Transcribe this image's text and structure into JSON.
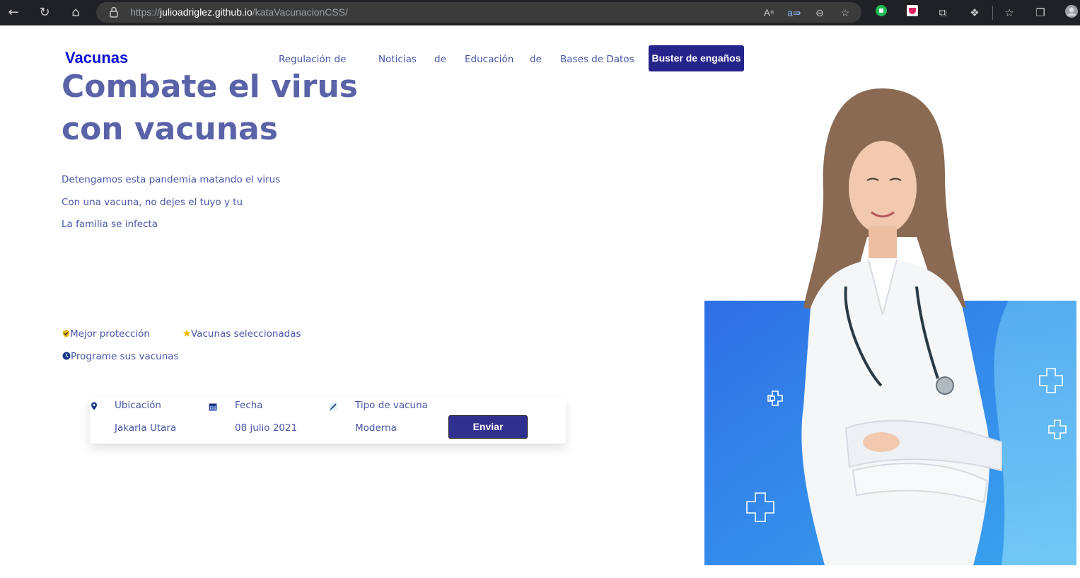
{
  "browser": {
    "url_prefix": "https://",
    "url_host": "julioadriglez.github.io",
    "url_path": "/kataVacunacionCSS/",
    "reader_icon_label": "Aᵀ"
  },
  "header": {
    "logo": "Vacunas",
    "nav": [
      {
        "label": "Regulación de"
      },
      {
        "label": "Noticias"
      },
      {
        "label": "de"
      },
      {
        "label": "Educación"
      },
      {
        "label": "de"
      },
      {
        "label": "Bases de Datos"
      }
    ],
    "cta_label": "Buster de engaños"
  },
  "hero": {
    "title_line1": "Combate el virus",
    "title_line2": "con vacunas",
    "lines": [
      "Detengamos esta pandemia matando el virus",
      "Con una vacuna, no dejes el tuyo y tu",
      "La familia se infecta"
    ]
  },
  "features": [
    {
      "label": "Mejor protección",
      "icon": "shield-check-icon",
      "color": "#e8b400"
    },
    {
      "label": "Vacunas seleccionadas",
      "icon": "star-icon",
      "color": "#f2b800"
    },
    {
      "label": "Programe sus vacunas",
      "icon": "clock-icon",
      "color": "#1a3a8a"
    }
  ],
  "booking": {
    "location_label": "Ubicación",
    "location_value": "Jakarla Utara",
    "date_label": "Fecha",
    "date_value": "08 julio 2021",
    "vaccine_label": "Tipo de vacuna",
    "vaccine_value": "Moderna",
    "submit_label": "Enviar"
  },
  "colors": {
    "brand": "#0b0bd6",
    "primary": "#24248a",
    "text": "#4a56a8",
    "title": "#5a62a8"
  }
}
